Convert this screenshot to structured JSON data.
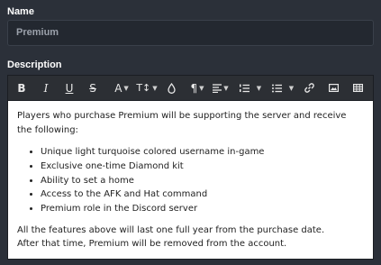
{
  "form": {
    "name_label": "Name",
    "name_value": "Premium",
    "description_label": "Description"
  },
  "toolbar": {
    "buttons": [
      {
        "name": "bold",
        "glyph": "B"
      },
      {
        "name": "italic",
        "glyph": "I"
      },
      {
        "name": "underline",
        "glyph": "U"
      },
      {
        "name": "strikethrough",
        "glyph": "S"
      },
      {
        "name": "font-color",
        "glyph": "A"
      },
      {
        "name": "font-size",
        "glyph": "T↕"
      },
      {
        "name": "text-color-drop",
        "glyph": ""
      },
      {
        "name": "paragraph",
        "glyph": "¶"
      },
      {
        "name": "align",
        "glyph": ""
      },
      {
        "name": "ordered-list",
        "glyph": ""
      },
      {
        "name": "unordered-list",
        "glyph": ""
      },
      {
        "name": "link",
        "glyph": ""
      },
      {
        "name": "image",
        "glyph": ""
      },
      {
        "name": "table",
        "glyph": ""
      }
    ]
  },
  "content": {
    "intro": "Players who purchase Premium will be supporting the server and receive the following:",
    "bullets": [
      "Unique light turquoise colored username in-game",
      "Exclusive one-time Diamond kit",
      "Ability to set a home",
      "Access to the AFK and Hat command",
      "Premium role in the Discord server"
    ],
    "outro_1": "All the features above will last one full year from the purchase date.",
    "outro_2": "After that time, Premium will be removed from the account."
  }
}
